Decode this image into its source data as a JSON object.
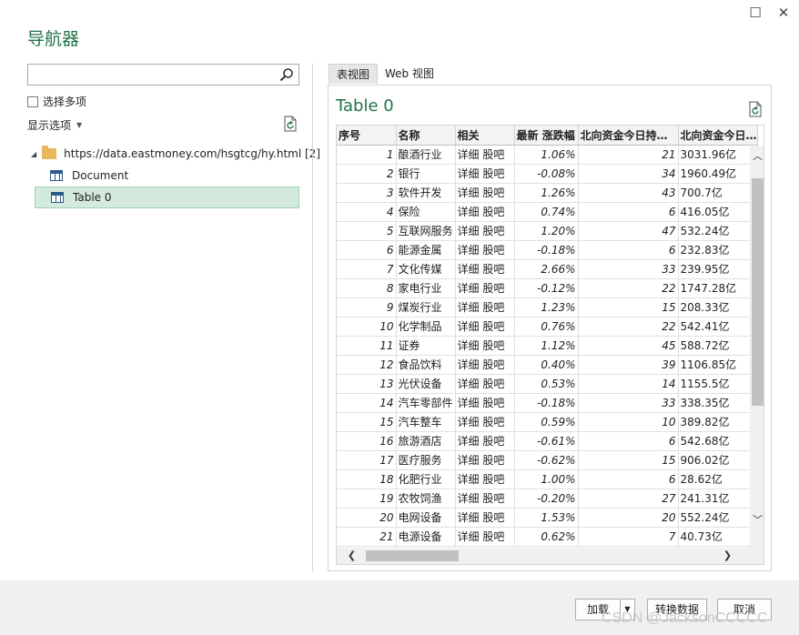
{
  "window": {
    "title": "导航器",
    "maximize_glyph": "☐",
    "close_glyph": "✕"
  },
  "left": {
    "search_value": "",
    "multi_select_label": "选择多项",
    "display_options_label": "显示选项",
    "tree": {
      "root_label": "https://data.eastmoney.com/hsgtcg/hy.html [2]",
      "items": [
        {
          "label": "Document",
          "icon": "table-icon"
        },
        {
          "label": "Table 0",
          "icon": "table-icon",
          "selected": true
        }
      ]
    }
  },
  "tabs": [
    {
      "label": "表视图",
      "active": true
    },
    {
      "label": "Web 视图",
      "active": false
    }
  ],
  "preview": {
    "title": "Table 0",
    "columns": [
      "序号",
      "名称",
      "相关",
      "最新 涨跌幅",
      "北向资金今日持…",
      "北向资金今日…"
    ],
    "rows": [
      [
        "1",
        "酿酒行业",
        "详细 股吧",
        "1.06%",
        "21",
        "3031.96亿"
      ],
      [
        "2",
        "银行",
        "详细 股吧",
        "-0.08%",
        "34",
        "1960.49亿"
      ],
      [
        "3",
        "软件开发",
        "详细 股吧",
        "1.26%",
        "43",
        "700.7亿"
      ],
      [
        "4",
        "保险",
        "详细 股吧",
        "0.74%",
        "6",
        "416.05亿"
      ],
      [
        "5",
        "互联网服务",
        "详细 股吧",
        "1.20%",
        "47",
        "532.24亿"
      ],
      [
        "6",
        "能源金属",
        "详细 股吧",
        "-0.18%",
        "6",
        "232.83亿"
      ],
      [
        "7",
        "文化传媒",
        "详细 股吧",
        "2.66%",
        "33",
        "239.95亿"
      ],
      [
        "8",
        "家电行业",
        "详细 股吧",
        "-0.12%",
        "22",
        "1747.28亿"
      ],
      [
        "9",
        "煤炭行业",
        "详细 股吧",
        "1.23%",
        "15",
        "208.33亿"
      ],
      [
        "10",
        "化学制品",
        "详细 股吧",
        "0.76%",
        "22",
        "542.41亿"
      ],
      [
        "11",
        "证券",
        "详细 股吧",
        "1.12%",
        "45",
        "588.72亿"
      ],
      [
        "12",
        "食品饮料",
        "详细 股吧",
        "0.40%",
        "39",
        "1106.85亿"
      ],
      [
        "13",
        "光伏设备",
        "详细 股吧",
        "0.53%",
        "14",
        "1155.5亿"
      ],
      [
        "14",
        "汽车零部件",
        "详细 股吧",
        "-0.18%",
        "33",
        "338.35亿"
      ],
      [
        "15",
        "汽车整车",
        "详细 股吧",
        "0.59%",
        "10",
        "389.82亿"
      ],
      [
        "16",
        "旅游酒店",
        "详细 股吧",
        "-0.61%",
        "6",
        "542.68亿"
      ],
      [
        "17",
        "医疗服务",
        "详细 股吧",
        "-0.62%",
        "15",
        "906.02亿"
      ],
      [
        "18",
        "化肥行业",
        "详细 股吧",
        "1.00%",
        "6",
        "28.62亿"
      ],
      [
        "19",
        "农牧饲渔",
        "详细 股吧",
        "-0.20%",
        "27",
        "241.31亿"
      ],
      [
        "20",
        "电网设备",
        "详细 股吧",
        "1.53%",
        "20",
        "552.24亿"
      ],
      [
        "21",
        "电源设备",
        "详细 股吧",
        "0.62%",
        "7",
        "40.73亿"
      ]
    ]
  },
  "footer": {
    "load_label": "加载",
    "transform_label": "转换数据",
    "cancel_label": "取消"
  },
  "watermark": "CSDN @JacksonCCCCC",
  "colors": {
    "accent": "#217346",
    "selection": "#d3eadd"
  }
}
